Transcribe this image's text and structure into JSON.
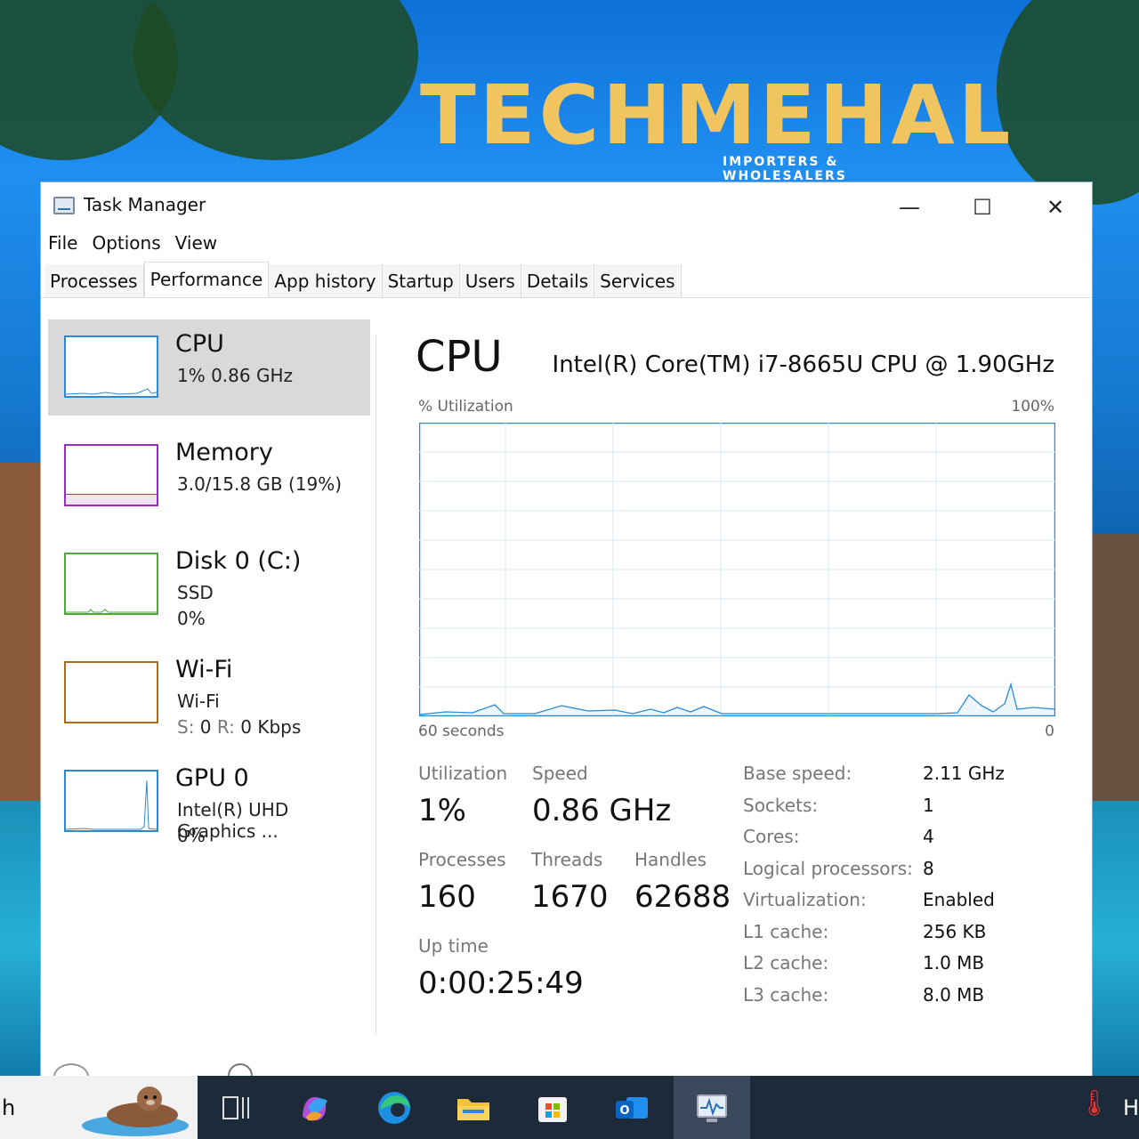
{
  "desktop": {
    "logo_text": "TECHMEHAL",
    "logo_subtitle": "IMPORTERS & WHOLESALERS"
  },
  "window": {
    "title": "Task Manager",
    "controls": {
      "minimize": "—",
      "maximize": "☐",
      "close": "✕"
    }
  },
  "menu": [
    "File",
    "Options",
    "View"
  ],
  "tabs": [
    {
      "label": "Processes"
    },
    {
      "label": "Performance"
    },
    {
      "label": "App history"
    },
    {
      "label": "Startup"
    },
    {
      "label": "Users"
    },
    {
      "label": "Details"
    },
    {
      "label": "Services"
    }
  ],
  "sidebar": [
    {
      "name": "CPU",
      "line1": "1%  0.86 GHz",
      "line2": "",
      "color": "#2a8ad4"
    },
    {
      "name": "Memory",
      "line1": "3.0/15.8 GB (19%)",
      "line2": "",
      "color": "#9b2dbf"
    },
    {
      "name": "Disk 0 (C:)",
      "line1": "SSD",
      "line2": "0%",
      "color": "#4fa83a"
    },
    {
      "name": "Wi-Fi",
      "line1": "Wi-Fi",
      "line2_s": "S:",
      "line2_sv": "0",
      "line2_r": "R:",
      "line2_rv": "0 Kbps",
      "color": "#b06a1e"
    },
    {
      "name": "GPU 0",
      "line1": "Intel(R) UHD Graphics ...",
      "line2": "0%",
      "color": "#2a8ad4"
    }
  ],
  "main": {
    "title": "CPU",
    "model": "Intel(R) Core(TM) i7-8665U CPU @ 1.90GHz",
    "graph_label_left": "% Utilization",
    "graph_label_right": "100%",
    "graph_foot_left": "60 seconds",
    "graph_foot_right": "0",
    "stats": {
      "utilization_label": "Utilization",
      "utilization_value": "1%",
      "speed_label": "Speed",
      "speed_value": "0.86 GHz",
      "processes_label": "Processes",
      "processes_value": "160",
      "threads_label": "Threads",
      "threads_value": "1670",
      "handles_label": "Handles",
      "handles_value": "62688",
      "uptime_label": "Up time",
      "uptime_value": "0:00:25:49"
    },
    "specs": [
      {
        "label": "Base speed:",
        "value": "2.11 GHz"
      },
      {
        "label": "Sockets:",
        "value": "1"
      },
      {
        "label": "Cores:",
        "value": "4"
      },
      {
        "label": "Logical processors:",
        "value": "8"
      },
      {
        "label": "Virtualization:",
        "value": "Enabled"
      },
      {
        "label": "L1 cache:",
        "value": "256 KB"
      },
      {
        "label": "L2 cache:",
        "value": "1.0 MB"
      },
      {
        "label": "L3 cache:",
        "value": "8.0 MB"
      }
    ]
  },
  "taskbar": {
    "search_text": "h",
    "tray_text": "H"
  }
}
